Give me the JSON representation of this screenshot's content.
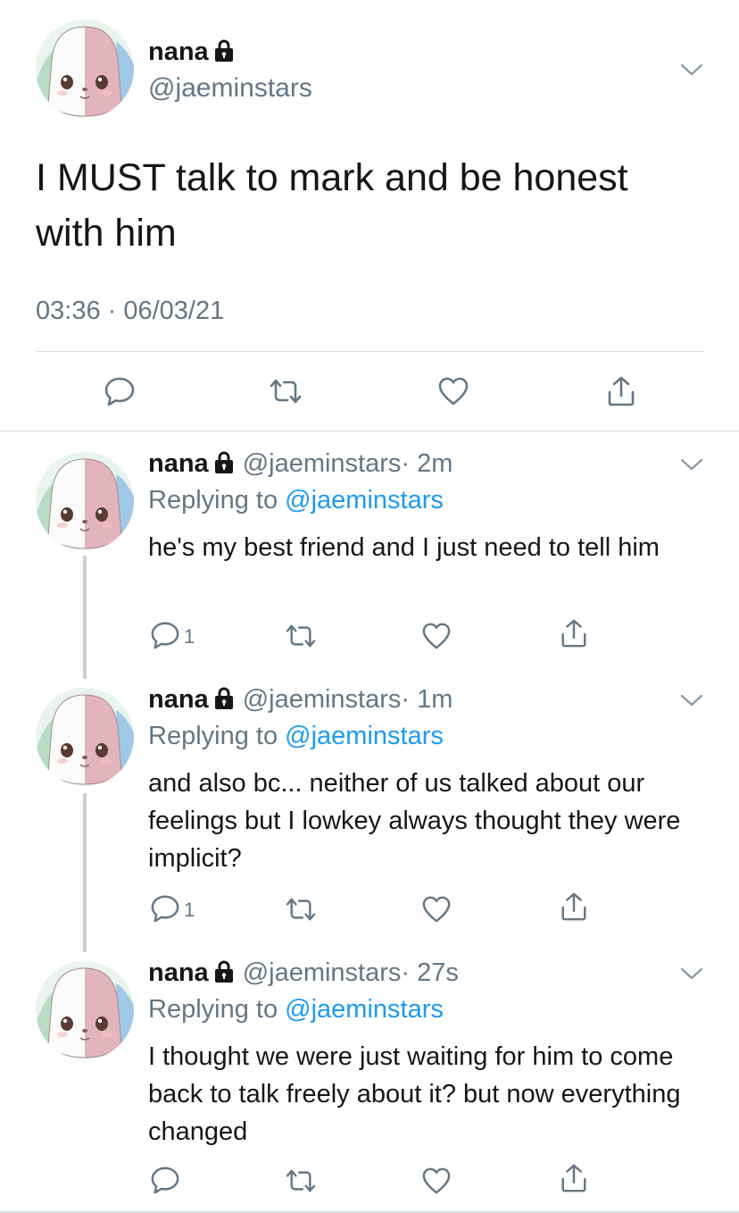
{
  "main_tweet": {
    "name": "nana",
    "handle": "@jaeminstars",
    "text": "I MUST talk to mark and be honest with him",
    "timestamp": "03:36 · 06/03/21"
  },
  "replies": [
    {
      "name": "nana",
      "handle": "@jaeminstars",
      "time": "· 2m",
      "replying_prefix": "Replying to",
      "replying_mention": "@jaeminstars",
      "text": "he's my best friend and I just need to tell him",
      "reply_count": "1"
    },
    {
      "name": "nana",
      "handle": "@jaeminstars",
      "time": "· 1m",
      "replying_prefix": "Replying to",
      "replying_mention": "@jaeminstars",
      "text": "and also bc... neither of us talked about our feelings but I lowkey always thought they were implicit?",
      "reply_count": "1"
    },
    {
      "name": "nana",
      "handle": "@jaeminstars",
      "time": "· 27s",
      "replying_prefix": "Replying to",
      "replying_mention": "@jaeminstars",
      "text": "I thought we were just waiting for him to come back to talk freely about it? but now everything changed",
      "reply_count": ""
    }
  ],
  "icons": {
    "reply": "reply-icon",
    "retweet": "retweet-icon",
    "like": "heart-icon",
    "share": "share-icon",
    "lock": "lock-icon",
    "menu": "chevron-down-icon"
  },
  "colors": {
    "accent": "#1d9bf0",
    "secondary_text": "#657786",
    "divider": "#d6dbe0"
  }
}
